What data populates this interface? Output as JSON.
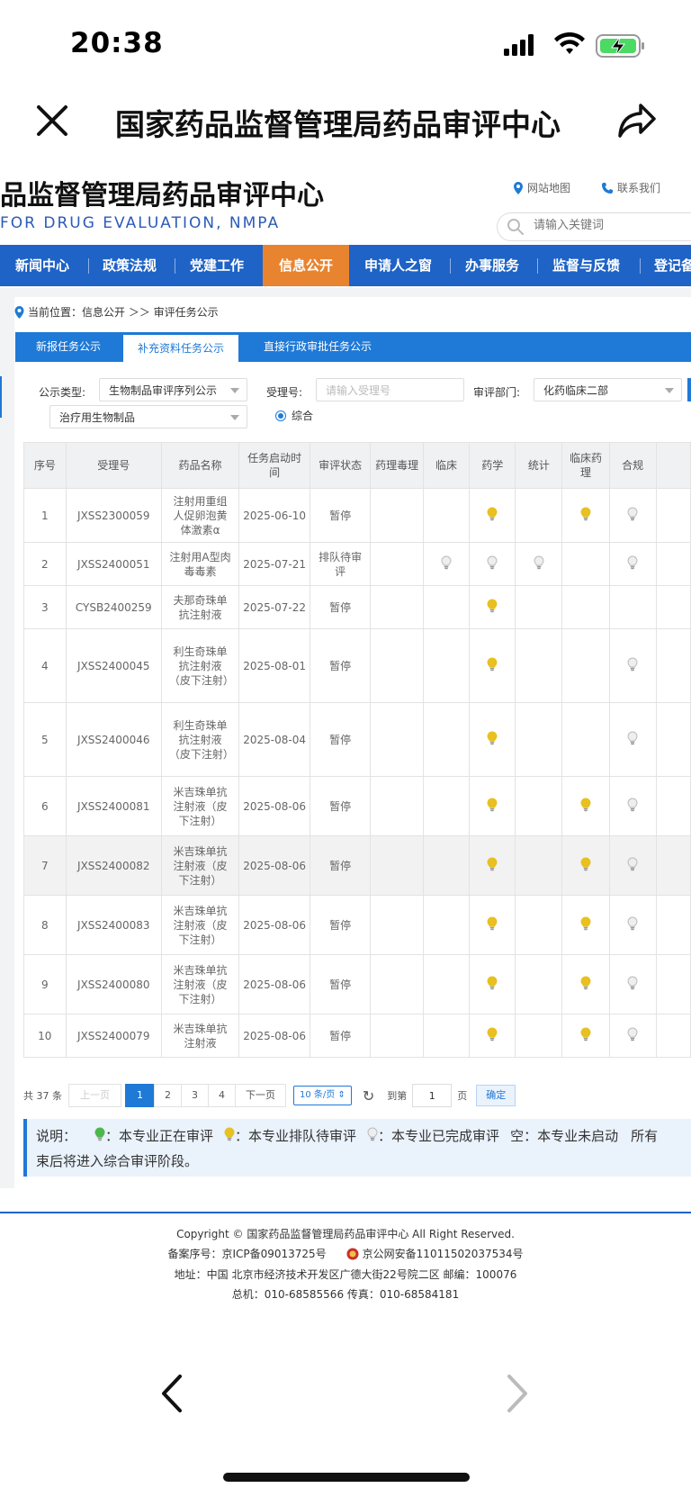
{
  "status_bar": {
    "time": "20:38"
  },
  "browser": {
    "title": "国家药品监督管理局药品审评中心"
  },
  "header": {
    "site_title": "品监督管理局药品审评中心",
    "site_subtitle": "FOR DRUG EVALUATION, NMPA",
    "sitemap_label": "网站地图",
    "contact_label": "联系我们",
    "search_placeholder": "请输入关键词"
  },
  "nav": {
    "items": [
      "新闻中心",
      "政策法规",
      "党建工作",
      "信息公开",
      "申请人之窗",
      "办事服务",
      "监督与反馈",
      "登记备"
    ],
    "active_index": 3
  },
  "breadcrumb": "当前位置：信息公开 ＞＞ 审评任务公示",
  "tabs": [
    "新报任务公示",
    "补充资料任务公示",
    "直接行政审批任务公示"
  ],
  "active_tab_index": 1,
  "filters": {
    "type_label": "公示类型:",
    "type_value": "生物制品审评序列公示",
    "subtype_value": "治疗用生物制品",
    "acceptance_label": "受理号:",
    "acceptance_placeholder": "请输入受理号",
    "dept_label": "审评部门:",
    "dept_value": "化药临床二部",
    "radio_label": "综合"
  },
  "table": {
    "headers": [
      "序号",
      "受理号",
      "药品名称",
      "任务启动时间",
      "审评状态",
      "药理毒理",
      "临床",
      "药学",
      "统计",
      "临床药理",
      "合规"
    ],
    "rows": [
      {
        "no": "1",
        "id": "JXSS2300059",
        "name": "注射用重组人促卵泡黄体激素α",
        "date": "2025-06-10",
        "status": "暂停",
        "tox": "",
        "clin": "",
        "pharm": "yellow",
        "stat": "",
        "cp": "yellow",
        "comp": "gray"
      },
      {
        "no": "2",
        "id": "JXSS2400051",
        "name": "注射用A型肉毒毒素",
        "date": "2025-07-21",
        "status": "排队待审评",
        "tox": "",
        "clin": "gray",
        "pharm": "gray",
        "stat": "gray",
        "cp": "",
        "comp": "gray"
      },
      {
        "no": "3",
        "id": "CYSB2400259",
        "name": "夫那奇珠单抗注射液",
        "date": "2025-07-22",
        "status": "暂停",
        "tox": "",
        "clin": "",
        "pharm": "yellow",
        "stat": "",
        "cp": "",
        "comp": ""
      },
      {
        "no": "4",
        "id": "JXSS2400045",
        "name": "利生奇珠单抗注射液（皮下注射）",
        "date": "2025-08-01",
        "status": "暂停",
        "tox": "",
        "clin": "",
        "pharm": "yellow",
        "stat": "",
        "cp": "",
        "comp": "gray"
      },
      {
        "no": "5",
        "id": "JXSS2400046",
        "name": "利生奇珠单抗注射液（皮下注射）",
        "date": "2025-08-04",
        "status": "暂停",
        "tox": "",
        "clin": "",
        "pharm": "yellow",
        "stat": "",
        "cp": "",
        "comp": "gray"
      },
      {
        "no": "6",
        "id": "JXSS2400081",
        "name": "米吉珠单抗注射液（皮下注射）",
        "date": "2025-08-06",
        "status": "暂停",
        "tox": "",
        "clin": "",
        "pharm": "yellow",
        "stat": "",
        "cp": "yellow",
        "comp": "gray"
      },
      {
        "no": "7",
        "id": "JXSS2400082",
        "name": "米吉珠单抗注射液（皮下注射）",
        "date": "2025-08-06",
        "status": "暂停",
        "tox": "",
        "clin": "",
        "pharm": "yellow",
        "stat": "",
        "cp": "yellow",
        "comp": "gray"
      },
      {
        "no": "8",
        "id": "JXSS2400083",
        "name": "米吉珠单抗注射液（皮下注射）",
        "date": "2025-08-06",
        "status": "暂停",
        "tox": "",
        "clin": "",
        "pharm": "yellow",
        "stat": "",
        "cp": "yellow",
        "comp": "gray"
      },
      {
        "no": "9",
        "id": "JXSS2400080",
        "name": "米吉珠单抗注射液（皮下注射）",
        "date": "2025-08-06",
        "status": "暂停",
        "tox": "",
        "clin": "",
        "pharm": "yellow",
        "stat": "",
        "cp": "yellow",
        "comp": "gray"
      },
      {
        "no": "10",
        "id": "JXSS2400079",
        "name": "米吉珠单抗注射液",
        "date": "2025-08-06",
        "status": "暂停",
        "tox": "",
        "clin": "",
        "pharm": "yellow",
        "stat": "",
        "cp": "yellow",
        "comp": "gray"
      }
    ]
  },
  "pagination": {
    "total": "共 37 条",
    "prev": "上一页",
    "pages": [
      "1",
      "2",
      "3",
      "4"
    ],
    "current": "1",
    "next": "下一页",
    "page_size": "10 条/页",
    "goto_label": "到第",
    "goto_value": "1",
    "page_unit": "页",
    "confirm": "确定"
  },
  "legend": {
    "prefix": "说明：",
    "in_review": "：本专业正在审评",
    "queued": "：本专业排队待审评",
    "done": "：本专业已完成审评",
    "empty": "空：本专业未启动",
    "tail": "所有",
    "line2": "束后将进入综合审评阶段。"
  },
  "footer": {
    "copyright": "Copyright © 国家药品监督管理局药品审评中心    All Right Reserved.",
    "icp": "备案序号：京ICP备09013725号",
    "police": "京公网安备11011502037534号",
    "address": "地址：中国 北京市经济技术开发区广德大街22号院二区      邮编：100076",
    "phone": "总机：010-68585566      传真：010-68584181"
  },
  "colors": {
    "nav_blue": "#1f63c6",
    "tab_blue": "#1f79d6",
    "active_orange": "#e8842f",
    "bulb_yellow": "#e8c020",
    "bulb_green": "#4cb84c",
    "bulb_gray": "#c8c8c8"
  }
}
